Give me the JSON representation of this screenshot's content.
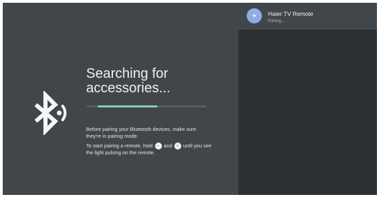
{
  "pairing": {
    "title_line1": "Searching for",
    "title_line2": "accessories...",
    "progress": 0.55,
    "instructions_line1": "Before pairing your Bluetooth devices, make sure they're in pairing mode.",
    "instructions_part1": "To start pairing a remote, hold",
    "instructions_and": "and",
    "instructions_part2": "until you see the light pulsing on the remote.",
    "back_button_icon": "back-arrow-icon",
    "home_button_icon": "home-icon"
  },
  "device_list": [
    {
      "name": "Haier TV Remote",
      "status": "Pairing...",
      "icon": "remote-icon"
    }
  ],
  "colors": {
    "background": "#414649",
    "panel": "#2c3033",
    "accent": "#8fc9b8",
    "avatar": "#8eaee0"
  }
}
